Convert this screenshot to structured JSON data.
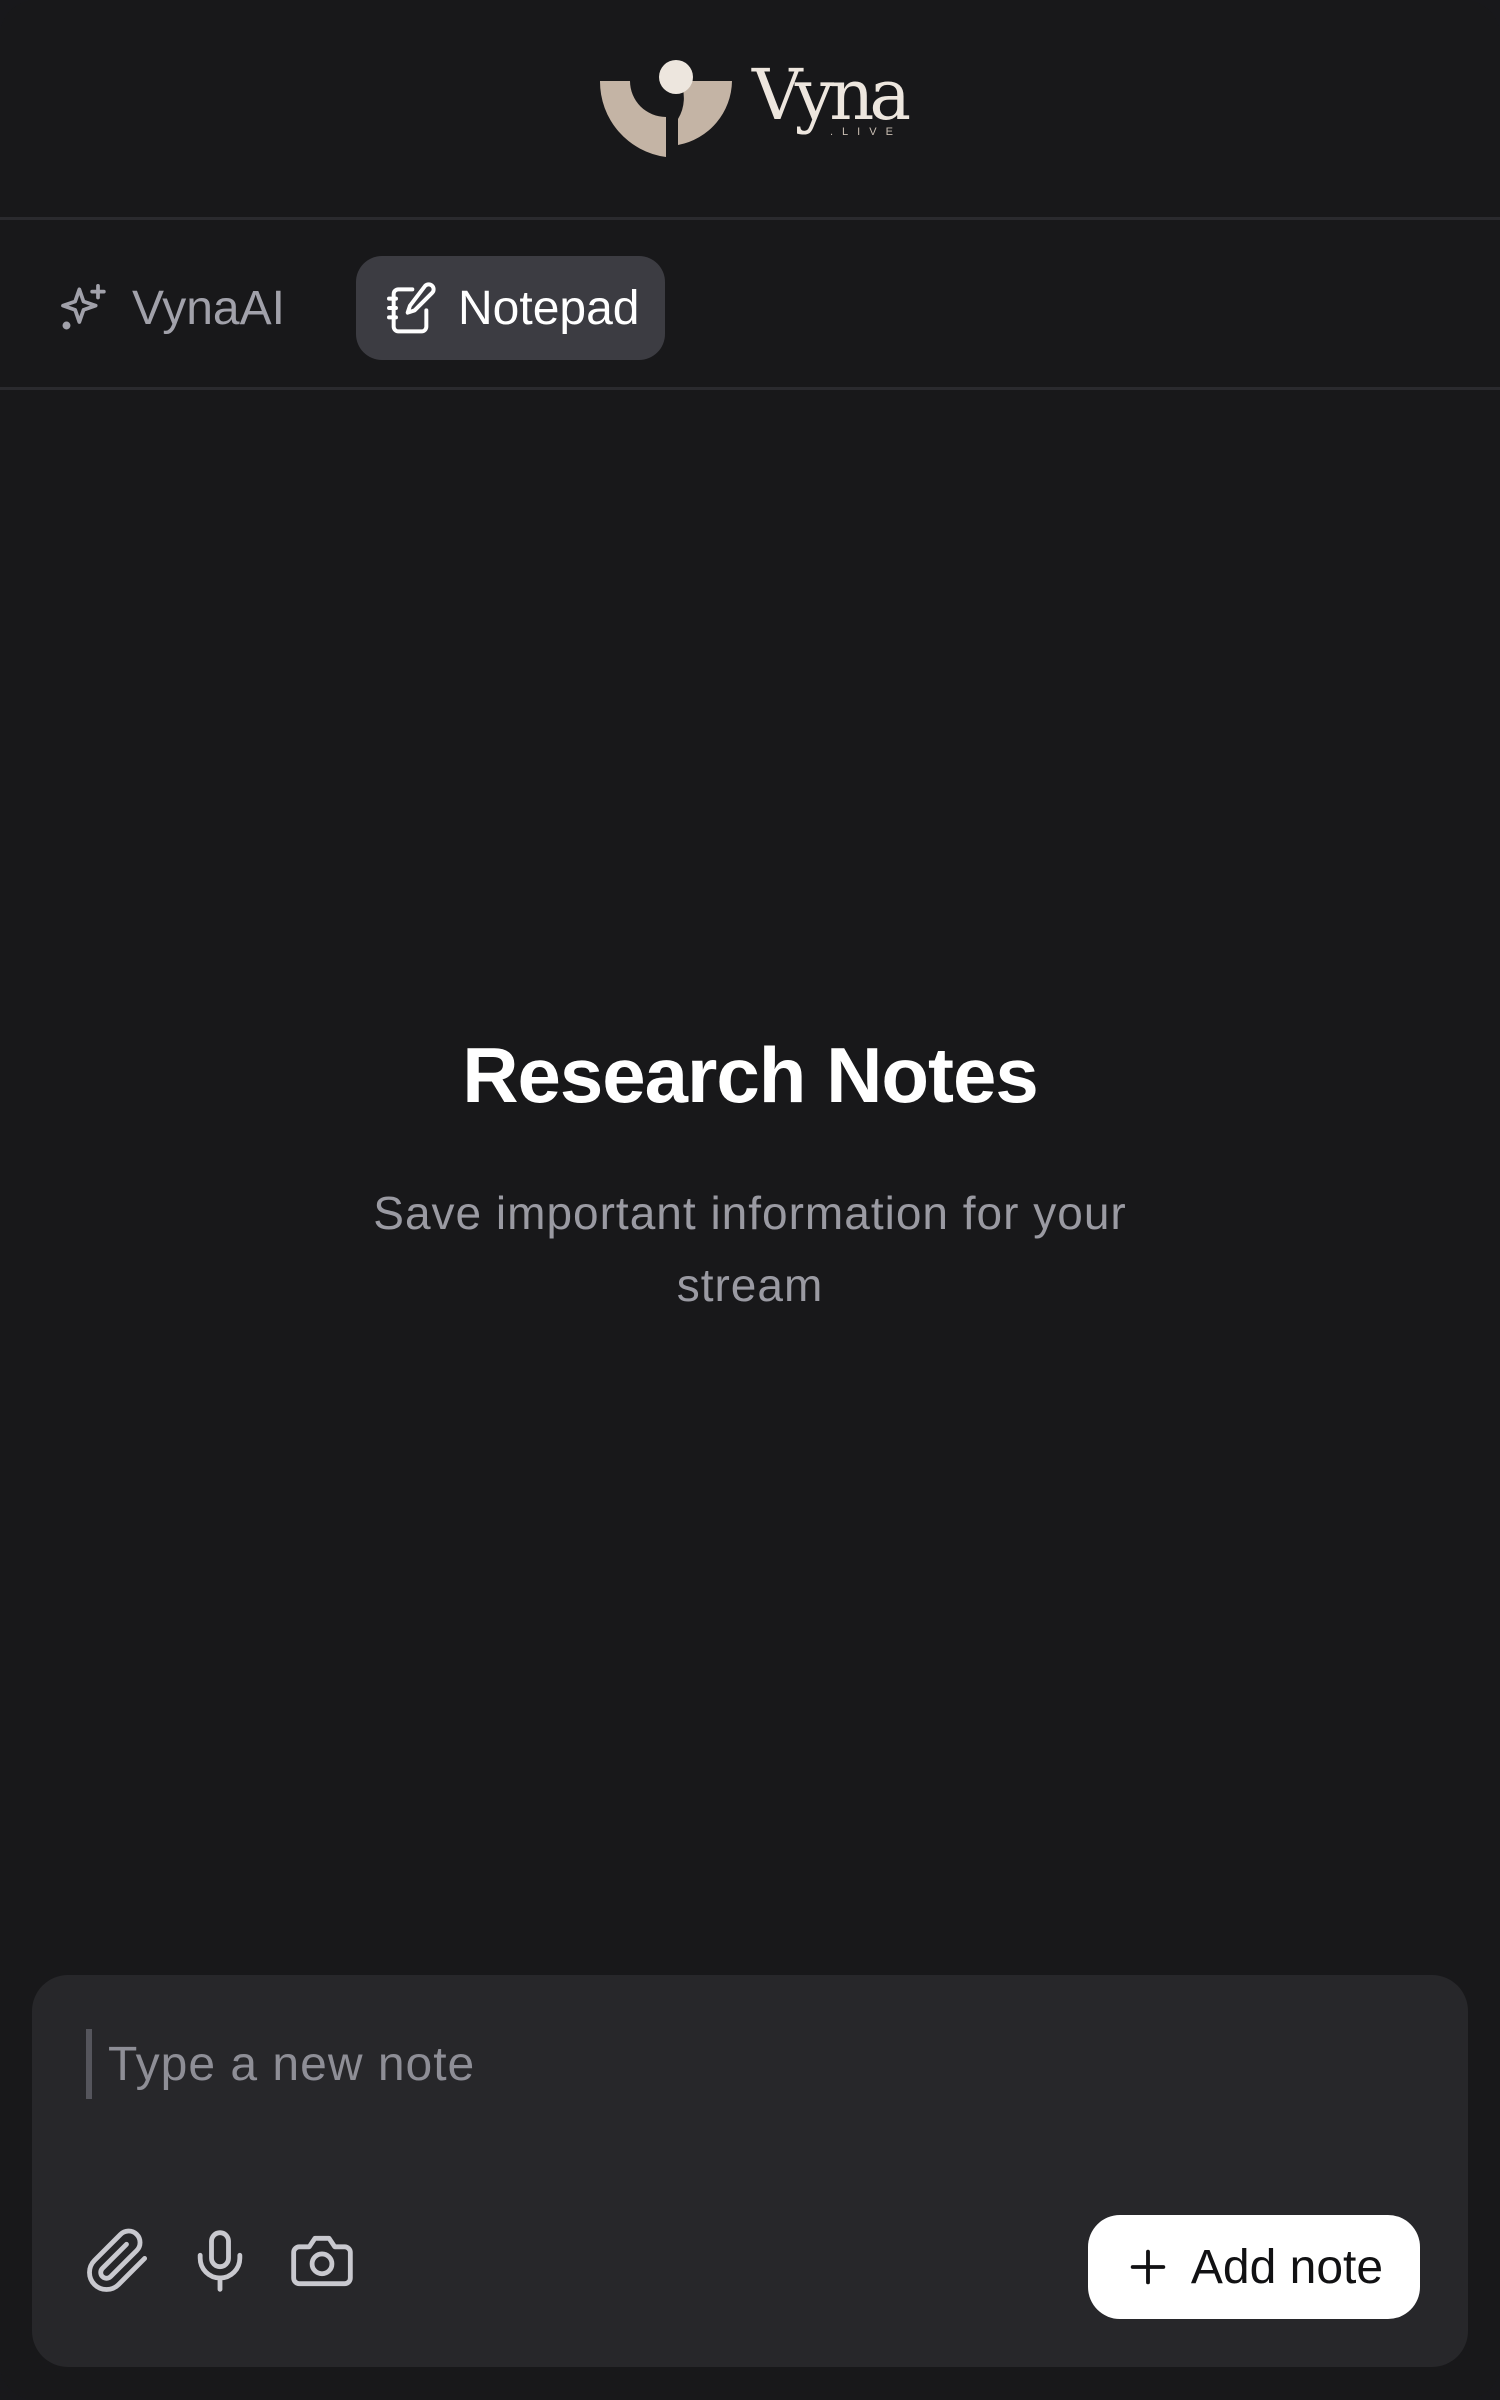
{
  "brand": {
    "wordmark": "Vyna",
    "suffix": ".LIVE",
    "colors": {
      "arc": "#c4b4a5",
      "dot": "#ede6de"
    }
  },
  "tabs": [
    {
      "label": "VynaAI",
      "icon": "sparkles-icon",
      "active": false
    },
    {
      "label": "Notepad",
      "icon": "notepad-icon",
      "active": true
    }
  ],
  "empty_state": {
    "title": "Research Notes",
    "subtitle": "Save important information for your stream"
  },
  "composer": {
    "placeholder": "Type a new note",
    "value": "",
    "tools": [
      {
        "icon": "paperclip-icon"
      },
      {
        "icon": "microphone-icon"
      },
      {
        "icon": "camera-icon"
      }
    ],
    "add_button": {
      "label": "Add note",
      "icon": "plus-icon"
    }
  },
  "theme": {
    "background": "#18181a",
    "surface": "#27272a",
    "active_tab": "#3c3c42",
    "text_primary": "#ffffff",
    "text_muted": "#9a9aa2"
  }
}
